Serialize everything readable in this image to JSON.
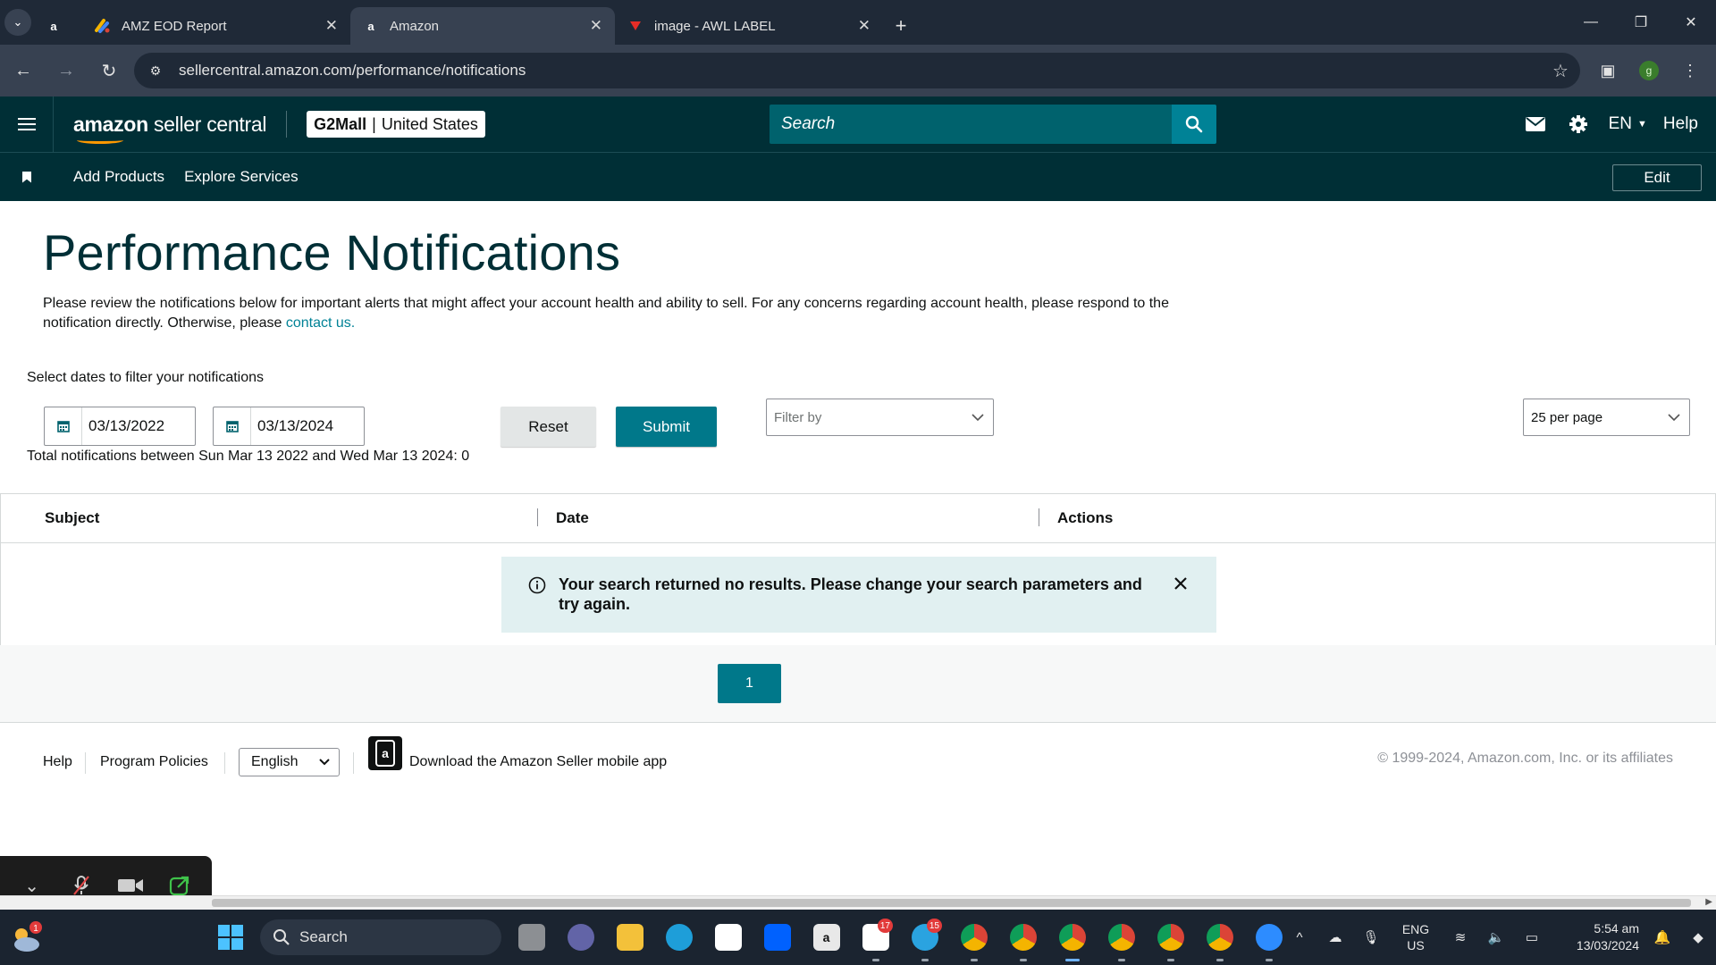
{
  "browser": {
    "tabs": [
      {
        "title": "",
        "favicon": "amazon-a",
        "pinned": true
      },
      {
        "title": "AMZ EOD Report",
        "favicon": "apps-script"
      },
      {
        "title": "Amazon",
        "favicon": "amazon-a",
        "active": true
      },
      {
        "title": "image - AWL LABEL",
        "favicon": "pdf"
      }
    ],
    "url": "sellercentral.amazon.com/performance/notifications",
    "profile_initial": "g"
  },
  "header": {
    "logo_brand": "amazon",
    "logo_product": "seller central",
    "store_name": "G2Mall",
    "store_region": "United States",
    "search_placeholder": "Search",
    "language": "EN",
    "help": "Help"
  },
  "subnav": {
    "links": [
      "Add Products",
      "Explore Services"
    ],
    "edit": "Edit"
  },
  "main": {
    "title": "Performance Notifications",
    "description": "Please review the notifications below for important alerts that might affect your account health and ability to sell. For any concerns regarding account health, please respond to the notification directly. Otherwise, please ",
    "contact_link": "contact us.",
    "filter_label": "Select dates to filter your notifications",
    "start_date": "03/13/2022",
    "end_date": "03/13/2024",
    "reset": "Reset",
    "submit": "Submit",
    "filter_placeholder": "Filter by",
    "per_page": "25 per page",
    "total_text": "Total notifications between Sun Mar 13 2022 and Wed Mar 13 2024: 0",
    "table_headers": [
      "Subject",
      "Date",
      "Actions"
    ],
    "no_results": "Your search returned no results. Please change your search parameters and try again.",
    "current_page": "1"
  },
  "footer": {
    "help": "Help",
    "program_policies": "Program Policies",
    "language": "English",
    "app_text": "Download the Amazon Seller mobile app",
    "copyright": "© 1999-2024, Amazon.com, Inc. or its affiliates"
  },
  "taskbar": {
    "search": "Search",
    "language": "ENG",
    "region": "US",
    "time": "5:54 am",
    "date": "13/03/2024",
    "weather_badge": "1",
    "badges": {
      "slack": "17",
      "telegram": "15"
    }
  },
  "colors": {
    "header_bg": "#002f36",
    "accent": "#008296",
    "button_primary": "#00788a",
    "alert_bg": "#e1f0f1"
  }
}
